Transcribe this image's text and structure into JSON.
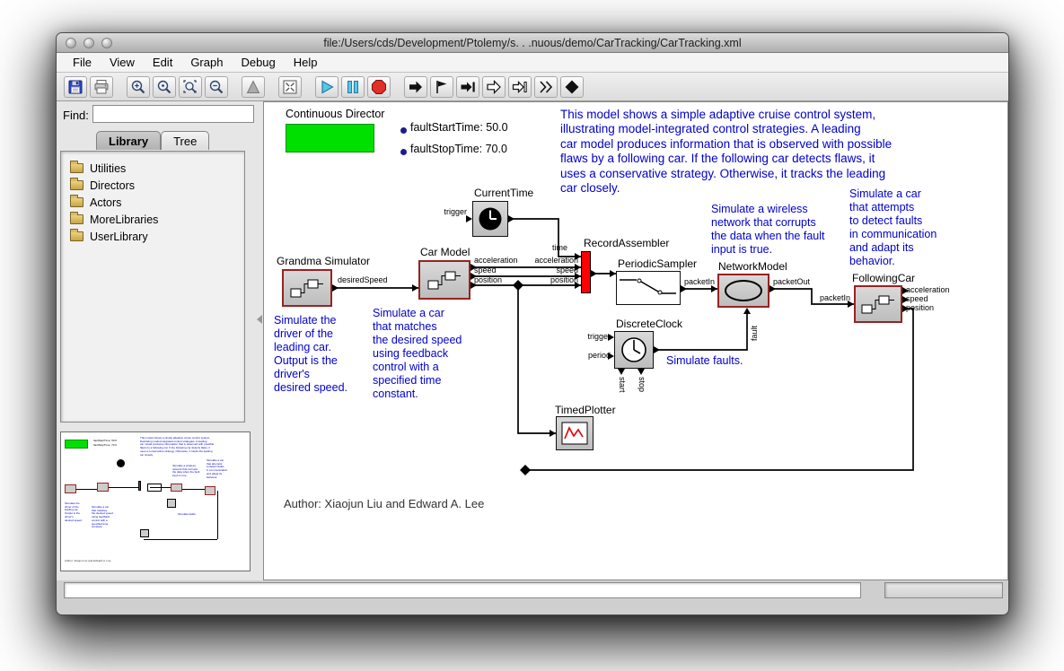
{
  "window": {
    "title": "file:/Users/cds/Development/Ptolemy/s. . .nuous/demo/CarTracking/CarTracking.xml"
  },
  "menu": {
    "items": [
      "File",
      "View",
      "Edit",
      "Graph",
      "Debug",
      "Help"
    ]
  },
  "toolbar": {
    "icons": [
      "save",
      "print",
      "zoom-in",
      "zoom-reset",
      "zoom-fit",
      "zoom-out",
      "pointer",
      "fullscreen",
      "play",
      "pause",
      "stop",
      "run",
      "flag",
      "go-to-end",
      "step",
      "step-over",
      "step-out",
      "halt"
    ]
  },
  "sidebar": {
    "find_label": "Find:",
    "find_value": "",
    "tabs": {
      "library": "Library",
      "tree": "Tree"
    },
    "items": [
      "Utilities",
      "Directors",
      "Actors",
      "MoreLibraries",
      "UserLibrary"
    ]
  },
  "canvas": {
    "director_label": "Continuous Director",
    "params": {
      "fault_start": "faultStartTime: 50.0",
      "fault_stop": "faultStopTime: 70.0"
    },
    "description": "This model shows a simple adaptive cruise control system,\nillustrating model-integrated control strategies. A leading\ncar model produces information that is observed with possible\nflaws by a following car. If the following car detects flaws, it\nuses a conservative strategy. Otherwise, it tracks the leading\ncar closely.",
    "actors": {
      "grandma": "Grandma Simulator",
      "car_model": "Car Model",
      "current_time": "CurrentTime",
      "record_assembler": "RecordAssembler",
      "periodic_sampler": "PeriodicSampler",
      "network_model": "NetworkModel",
      "discrete_clock": "DiscreteClock",
      "following_car": "FollowingCar",
      "timed_plotter": "TimedPlotter"
    },
    "ports": {
      "ct_trigger": "trigger",
      "desired_speed": "desiredSpeed",
      "cm_acceleration": "acceleration",
      "cm_speed": "speed",
      "cm_position": "position",
      "ra_time": "time",
      "ra_acceleration": "acceleration",
      "ra_speed": "speed",
      "ra_position": "position",
      "nm_packet_in": "packetIn",
      "nm_packet_out": "packetOut",
      "nm_fault": "fault",
      "fc_packet_in": "packetIn",
      "fc_acceleration": "acceleration",
      "fc_speed": "speed",
      "fc_position": "position",
      "dc_trigger": "trigger",
      "dc_period": "period",
      "dc_start": "start",
      "dc_stop": "stop"
    },
    "annotations": {
      "driver": "Simulate the\ndriver of the\nleading car.\nOutput is the\ndriver's\ndesired speed.",
      "car": "Simulate a car\nthat matches\nthe desired speed\nusing feedback\ncontrol with a\nspecified time\nconstant.",
      "network": "Simulate a wireless\nnetwork that corrupts\nthe data when the fault\ninput is true.",
      "following": "Simulate a car\nthat attempts\nto detect faults\nin communication\nand adapt its\nbehavior.",
      "faults": "Simulate faults."
    },
    "author": "Author: Xiaojun Liu and Edward A. Lee"
  },
  "colors": {
    "annotation_blue": "#0000cc",
    "director_green": "#00e000",
    "actor_border": "#992222",
    "record_red": "#ff0000"
  }
}
